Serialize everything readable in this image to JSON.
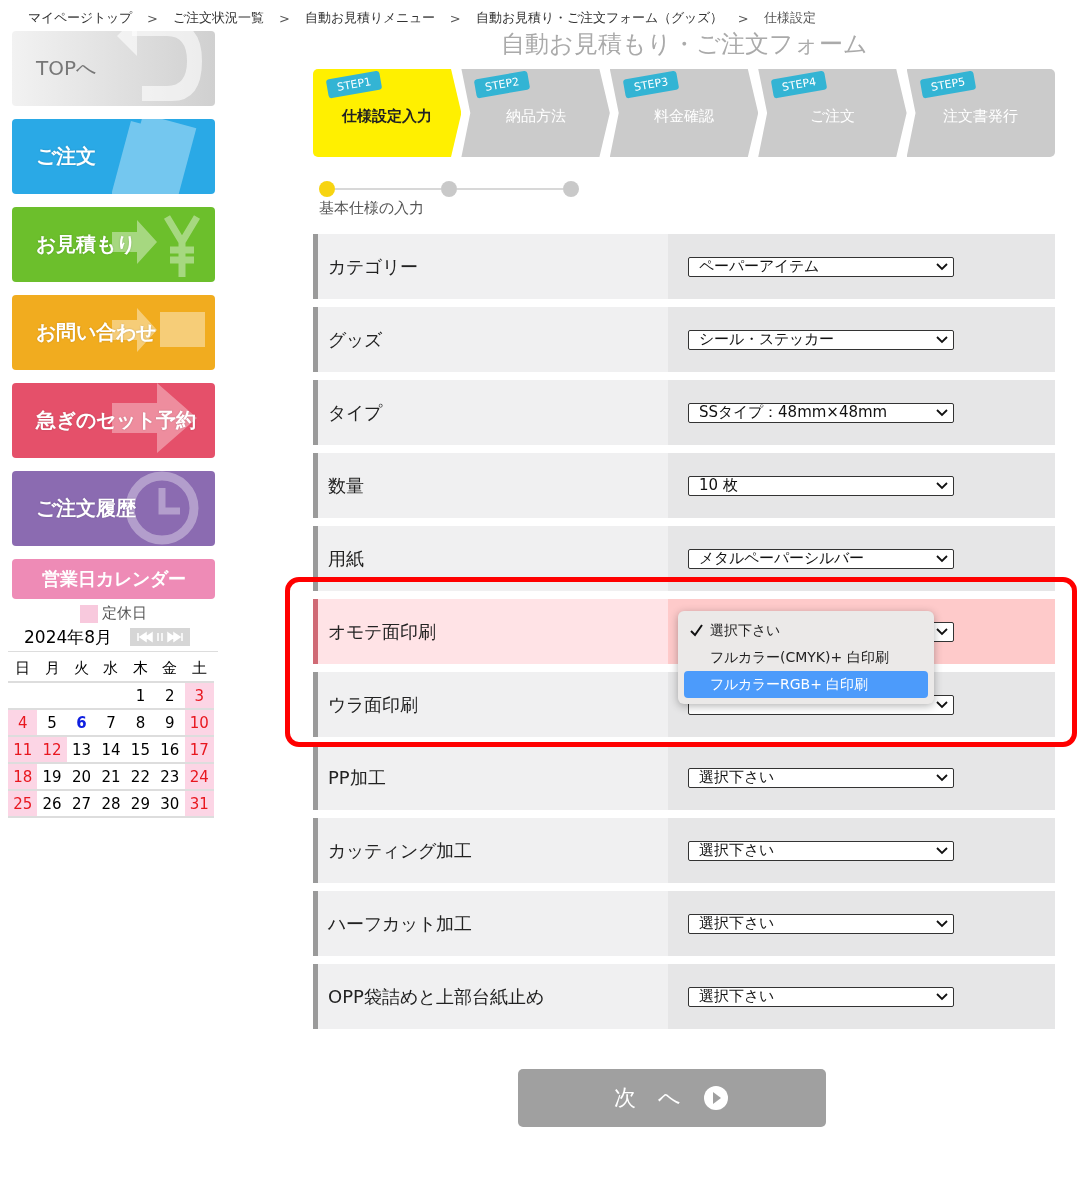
{
  "breadcrumb": [
    {
      "kind": "link",
      "label": "マイページトップ"
    },
    {
      "kind": "separator",
      "label": ">"
    },
    {
      "kind": "link",
      "label": "ご注文状況一覧"
    },
    {
      "kind": "separator",
      "label": ">"
    },
    {
      "kind": "link",
      "label": "自動お見積りメニュー"
    },
    {
      "kind": "separator",
      "label": ">"
    },
    {
      "kind": "link",
      "label": "自動お見積り・ご注文フォーム（グッズ）"
    },
    {
      "kind": "separator",
      "label": ">"
    },
    {
      "kind": "current",
      "label": "仕様設定"
    }
  ],
  "sidebar": {
    "items": [
      {
        "label": "TOPへ",
        "color": "#dcdcdc"
      },
      {
        "label": "ご注文",
        "color": "#2aa9e6"
      },
      {
        "label": "お見積もり",
        "color": "#6cbf2c"
      },
      {
        "label": "お問い合わせ",
        "color": "#f1ac1f"
      },
      {
        "label": "急ぎのセット予約",
        "color": "#e5506a"
      },
      {
        "label": "ご注文履歴",
        "color": "#8b6bb1"
      }
    ]
  },
  "calendar": {
    "title": "営業日カレンダー",
    "legend": "定休日",
    "month": "2024年8月",
    "weekdays": [
      "日",
      "月",
      "火",
      "水",
      "木",
      "金",
      "土"
    ],
    "weeks": [
      [
        {
          "kind": "blank"
        },
        {
          "kind": "blank"
        },
        {
          "kind": "blank"
        },
        {
          "kind": "blank"
        },
        {
          "kind": "day",
          "day": "1",
          "holiday": false,
          "today": false
        },
        {
          "kind": "day",
          "day": "2",
          "holiday": false,
          "today": false
        },
        {
          "kind": "day",
          "day": "3",
          "holiday": true,
          "today": false
        }
      ],
      [
        {
          "kind": "day",
          "day": "4",
          "holiday": true,
          "today": false
        },
        {
          "kind": "day",
          "day": "5",
          "holiday": false,
          "today": false
        },
        {
          "kind": "day",
          "day": "6",
          "holiday": false,
          "today": true
        },
        {
          "kind": "day",
          "day": "7",
          "holiday": false,
          "today": false
        },
        {
          "kind": "day",
          "day": "8",
          "holiday": false,
          "today": false
        },
        {
          "kind": "day",
          "day": "9",
          "holiday": false,
          "today": false
        },
        {
          "kind": "day",
          "day": "10",
          "holiday": true,
          "today": false
        }
      ],
      [
        {
          "kind": "day",
          "day": "11",
          "holiday": true,
          "today": false
        },
        {
          "kind": "day",
          "day": "12",
          "holiday": true,
          "today": false
        },
        {
          "kind": "day",
          "day": "13",
          "holiday": false,
          "today": false
        },
        {
          "kind": "day",
          "day": "14",
          "holiday": false,
          "today": false
        },
        {
          "kind": "day",
          "day": "15",
          "holiday": false,
          "today": false
        },
        {
          "kind": "day",
          "day": "16",
          "holiday": false,
          "today": false
        },
        {
          "kind": "day",
          "day": "17",
          "holiday": true,
          "today": false
        }
      ],
      [
        {
          "kind": "day",
          "day": "18",
          "holiday": true,
          "today": false
        },
        {
          "kind": "day",
          "day": "19",
          "holiday": false,
          "today": false
        },
        {
          "kind": "day",
          "day": "20",
          "holiday": false,
          "today": false
        },
        {
          "kind": "day",
          "day": "21",
          "holiday": false,
          "today": false
        },
        {
          "kind": "day",
          "day": "22",
          "holiday": false,
          "today": false
        },
        {
          "kind": "day",
          "day": "23",
          "holiday": false,
          "today": false
        },
        {
          "kind": "day",
          "day": "24",
          "holiday": true,
          "today": false
        }
      ],
      [
        {
          "kind": "day",
          "day": "25",
          "holiday": true,
          "today": false
        },
        {
          "kind": "day",
          "day": "26",
          "holiday": false,
          "today": false
        },
        {
          "kind": "day",
          "day": "27",
          "holiday": false,
          "today": false
        },
        {
          "kind": "day",
          "day": "28",
          "holiday": false,
          "today": false
        },
        {
          "kind": "day",
          "day": "29",
          "holiday": false,
          "today": false
        },
        {
          "kind": "day",
          "day": "30",
          "holiday": false,
          "today": false
        },
        {
          "kind": "day",
          "day": "31",
          "holiday": true,
          "today": false
        }
      ]
    ]
  },
  "title": "自動お見積もり・ご注文フォーム",
  "steps": [
    {
      "tag": "STEP1",
      "label": "仕様設定入力",
      "selected": true
    },
    {
      "tag": "STEP2",
      "label": "納品方法",
      "selected": false
    },
    {
      "tag": "STEP3",
      "label": "料金確認",
      "selected": false
    },
    {
      "tag": "STEP4",
      "label": "ご注文",
      "selected": false
    },
    {
      "tag": "STEP5",
      "label": "注文書発行",
      "selected": false
    }
  ],
  "progress": {
    "dots": [
      {
        "selected": true
      },
      {
        "selected": false
      },
      {
        "selected": false
      }
    ],
    "label": "基本仕様の入力"
  },
  "form_sections": [
    {
      "kind": "plain",
      "rows": [
        {
          "label": "カテゴリー",
          "value": "ペーパーアイテム",
          "active": false
        },
        {
          "label": "グッズ",
          "value": "シール・ステッカー",
          "active": false
        },
        {
          "label": "タイプ",
          "value": "SSタイプ：48mm×48mm",
          "active": false
        },
        {
          "label": "数量",
          "value": "10 枚",
          "active": false
        },
        {
          "label": "用紙",
          "value": "メタルペーパーシルバー",
          "active": false
        }
      ]
    },
    {
      "kind": "outlined",
      "rows": [
        {
          "label": "オモテ面印刷",
          "active": true,
          "menu": [
            {
              "label": "選択下さい",
              "checked": true,
              "highlighted": false
            },
            {
              "label": "フルカラー(CMYK)+ 白印刷",
              "checked": false,
              "highlighted": false
            },
            {
              "label": "フルカラーRGB+ 白印刷",
              "checked": false,
              "highlighted": true
            }
          ]
        },
        {
          "label": "ウラ面印刷",
          "active": false
        }
      ]
    },
    {
      "kind": "plain",
      "rows": [
        {
          "label": "PP加工",
          "value": "選択下さい",
          "active": false
        },
        {
          "label": "カッティング加工",
          "value": "選択下さい",
          "active": false
        },
        {
          "label": "ハーフカット加工",
          "value": "選択下さい",
          "active": false
        },
        {
          "label": "OPP袋詰めと上部台紙止め",
          "value": "選択下さい",
          "active": false
        }
      ]
    }
  ],
  "next_button": "次　へ"
}
